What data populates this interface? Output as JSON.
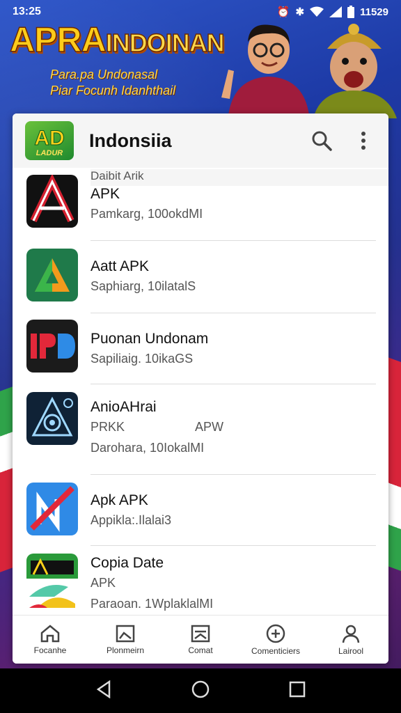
{
  "status_bar": {
    "time": "13:25",
    "battery_text": "11529",
    "icons": [
      "alarm-icon",
      "vibrate-icon",
      "wifi-icon",
      "signal-icon",
      "battery-icon"
    ]
  },
  "banner": {
    "title_main": "APRA",
    "title_small": "INDOINAN",
    "subtitle_line1": "Para.pa Undonasal",
    "subtitle_line2": "Piar Focunh Idanhthail"
  },
  "header": {
    "logo_text": "AD",
    "logo_sub": "LADUR",
    "title": "Indonsiia",
    "subcaption": "Daibit Arik",
    "search_icon": "search-icon",
    "more_icon": "more-vert-icon"
  },
  "apps": [
    {
      "name": "APK",
      "meta": "Pamkarg, 100okdMI",
      "tag": ""
    },
    {
      "name": "Aatt APK",
      "meta": "Saphiarg, 10ilatalS",
      "tag": ""
    },
    {
      "name": "Puonan Undonam",
      "meta": "Sapiliaig. 10ikaGS",
      "tag": ""
    },
    {
      "name": "AnioAHrai",
      "meta": "Darohara, 10IokalMI",
      "tag_left": "PRKK",
      "tag_right": "APW"
    },
    {
      "name": "Apk APK",
      "meta": "Appikla:.Ilalai3",
      "tag": ""
    },
    {
      "name": "Copia Date",
      "meta": "Paraoan. 1WplaklalMI",
      "tag": "APK"
    }
  ],
  "bottom_nav": [
    {
      "label": "Focanhe",
      "icon": "home-icon"
    },
    {
      "label": "Plonmeirn",
      "icon": "image-icon"
    },
    {
      "label": "Comat",
      "icon": "picture-icon"
    },
    {
      "label": "Comenticiers",
      "icon": "compass-icon"
    },
    {
      "label": "Lairool",
      "icon": "person-icon"
    }
  ],
  "colors": {
    "background": "#1d3aa6",
    "banner_title": "#ffcc1a",
    "card": "#ffffff",
    "header_bg": "#f5f5f5"
  }
}
